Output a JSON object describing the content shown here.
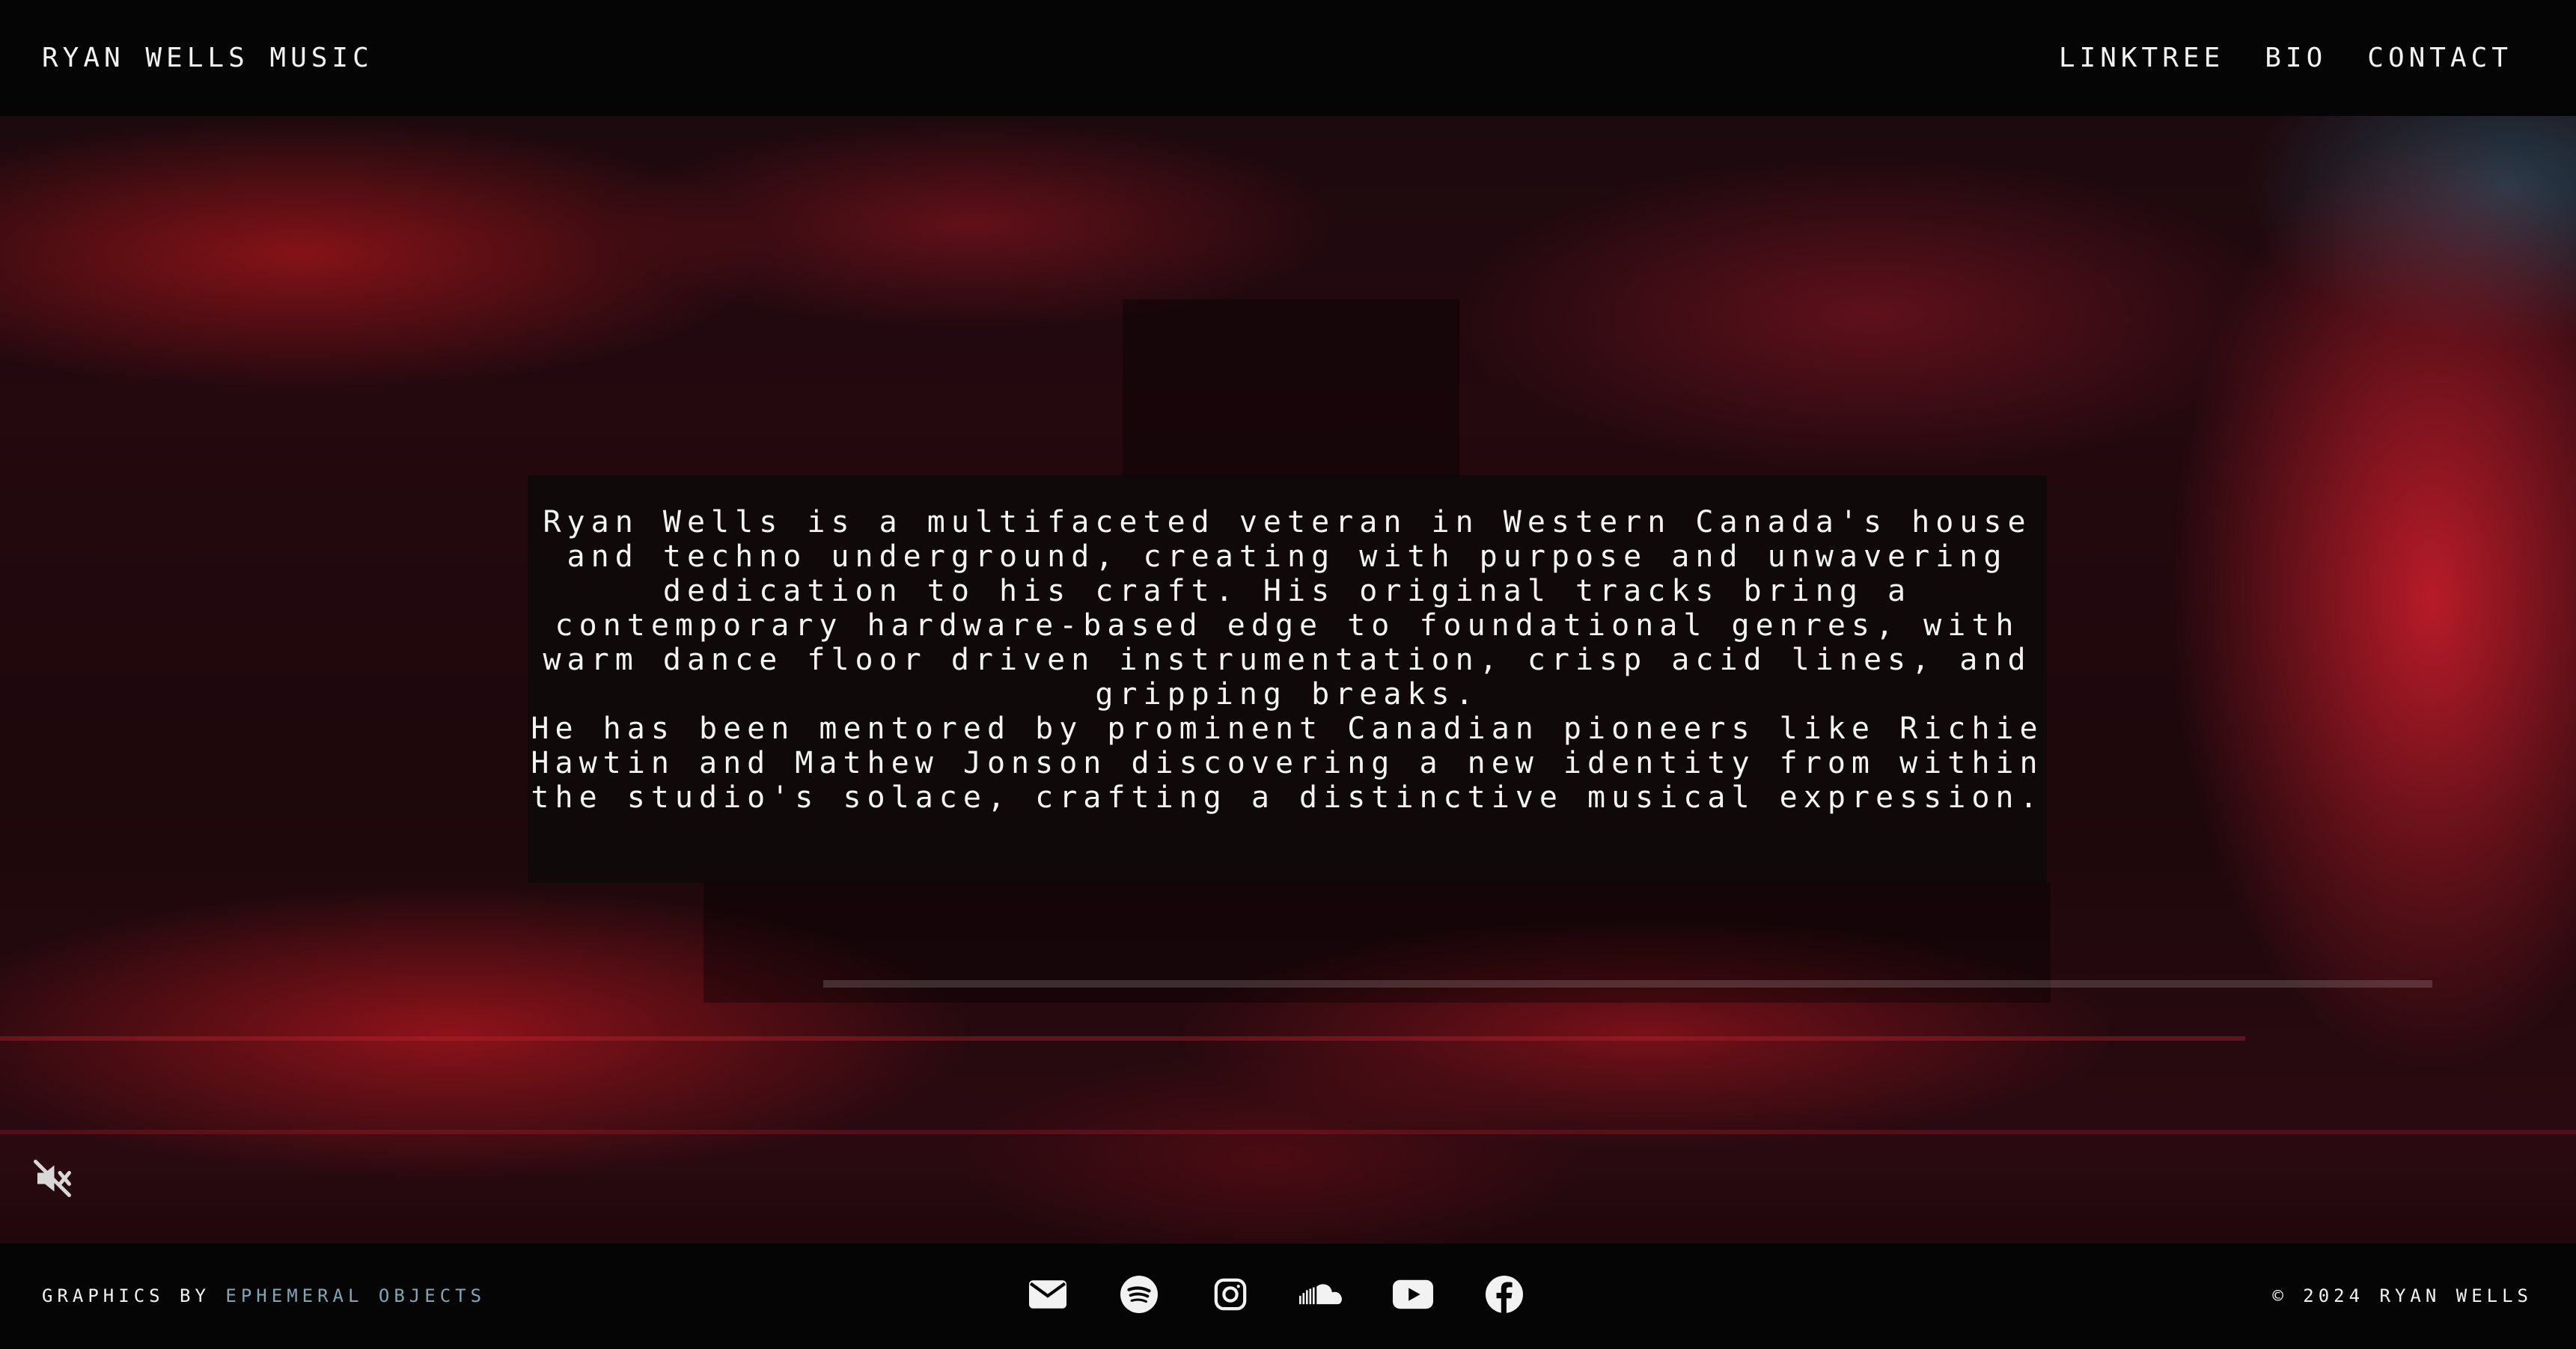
{
  "header": {
    "brand": "RYAN WELLS MUSIC",
    "nav": [
      {
        "label": "LINKTREE"
      },
      {
        "label": "BIO"
      },
      {
        "label": "CONTACT"
      }
    ]
  },
  "bio": {
    "paragraph1": "Ryan Wells is a multifaceted veteran in Western Canada's house and techno underground, creating with purpose and unwavering dedication to his craft. His original tracks bring a contemporary hardware-based edge to foundational genres, with warm dance floor driven instrumentation, crisp acid lines, and gripping breaks.",
    "paragraph2": "He has been mentored by prominent Canadian pioneers like Richie Hawtin and Mathew Jonson discovering a new identity from within the studio's solace, crafting a distinctive musical expression."
  },
  "controls": {
    "mute_icon": "volume-muted-icon"
  },
  "footer": {
    "credits_prefix": "GRAPHICS BY",
    "credits_link": "EPHEMERAL OBJECTS",
    "credits_link_color": "#7ea8b8",
    "social_icons": [
      "email-icon",
      "spotify-icon",
      "instagram-icon",
      "soundcloud-icon",
      "youtube-icon",
      "facebook-icon"
    ],
    "copyright": "© 2024 RYAN WELLS"
  }
}
